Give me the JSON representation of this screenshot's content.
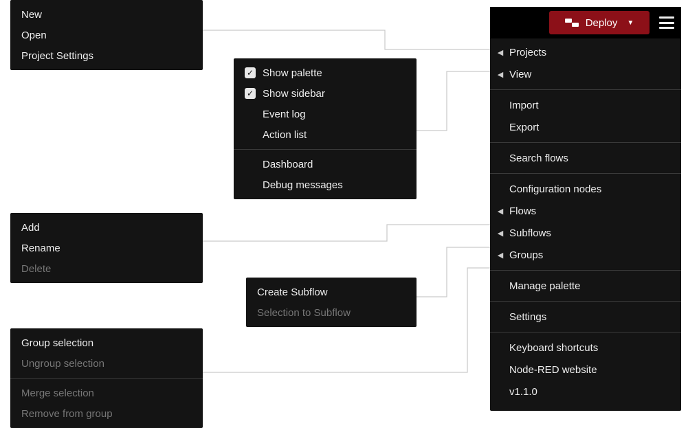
{
  "header": {
    "deploy_label": "Deploy"
  },
  "main_menu": {
    "projects": "Projects",
    "view": "View",
    "import": "Import",
    "export": "Export",
    "search_flows": "Search flows",
    "configuration_nodes": "Configuration nodes",
    "flows": "Flows",
    "subflows": "Subflows",
    "groups": "Groups",
    "manage_palette": "Manage palette",
    "settings": "Settings",
    "keyboard_shortcuts": "Keyboard shortcuts",
    "website": "Node-RED website",
    "version": "v1.1.0"
  },
  "projects_menu": {
    "new": "New",
    "open": "Open",
    "project_settings": "Project Settings"
  },
  "view_menu": {
    "show_palette": "Show palette",
    "show_sidebar": "Show sidebar",
    "event_log": "Event log",
    "action_list": "Action list",
    "dashboard": "Dashboard",
    "debug_messages": "Debug messages"
  },
  "flows_menu": {
    "add": "Add",
    "rename": "Rename",
    "delete": "Delete"
  },
  "subflows_menu": {
    "create": "Create Subflow",
    "selection": "Selection to Subflow"
  },
  "groups_menu": {
    "group": "Group selection",
    "ungroup": "Ungroup selection",
    "merge": "Merge selection",
    "remove": "Remove from group"
  }
}
